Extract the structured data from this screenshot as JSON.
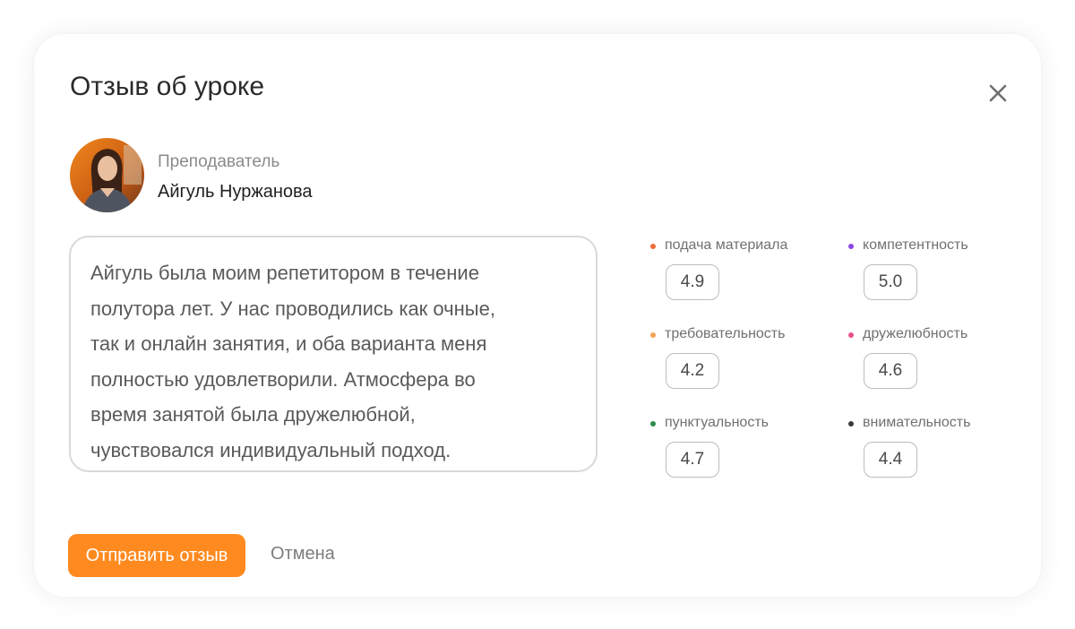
{
  "dialog": {
    "title": "Отзыв об уроке"
  },
  "teacher": {
    "role": "Преподаватель",
    "name": "Айгуль Нуржанова"
  },
  "review": {
    "lines": [
      "Айгуль была моим репетитором в течение",
      "полутора лет. У нас проводились как очные,",
      "так и онлайн занятия, и оба варианта меня",
      "полностью удовлетворили. Атмосфера во",
      "время занятой была дружелюбной,",
      "чувствовался индивидуальный подход."
    ]
  },
  "ratings": [
    {
      "label": "подача материала",
      "value": "4.9",
      "color": "#f26b3a"
    },
    {
      "label": "компетентность",
      "value": "5.0",
      "color": "#8b46e6"
    },
    {
      "label": "требовательность",
      "value": "4.2",
      "color": "#f4a456"
    },
    {
      "label": "дружелюбность",
      "value": "4.6",
      "color": "#e8508a"
    },
    {
      "label": "пунктуальность",
      "value": "4.7",
      "color": "#2e8b4a"
    },
    {
      "label": "внимательность",
      "value": "4.4",
      "color": "#3a3a3a"
    }
  ],
  "actions": {
    "submit": "Отправить отзыв",
    "cancel": "Отмена"
  },
  "icons": {
    "close": "close-icon",
    "avatar": "teacher-avatar"
  },
  "colors": {
    "accent": "#ff8a1f"
  }
}
